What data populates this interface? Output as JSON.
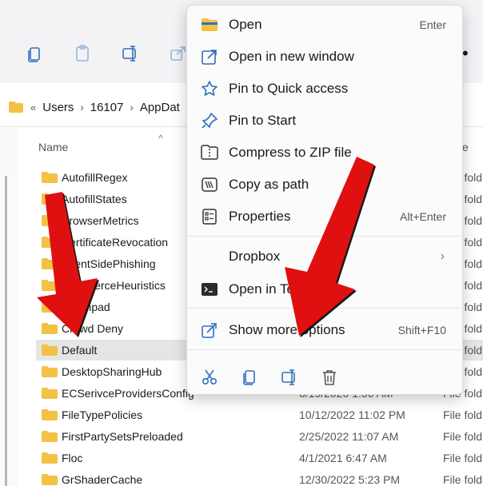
{
  "address": {
    "crumbs": [
      "Users",
      "16107",
      "AppDat"
    ]
  },
  "file_list": {
    "columns": {
      "name": "Name",
      "type_partial": "e"
    },
    "rows": [
      {
        "name": "AutofillRegex",
        "date": "",
        "type": "File fold"
      },
      {
        "name": "AutofillStates",
        "date": "",
        "type": "File fold"
      },
      {
        "name": "BrowserMetrics",
        "date": "",
        "type": "File fold"
      },
      {
        "name": "CertificateRevocation",
        "date": "",
        "type": "File fold"
      },
      {
        "name": "ClientSidePhishing",
        "date": "",
        "type": "File fold"
      },
      {
        "name": "CommerceHeuristics",
        "date": "",
        "type": "File fold"
      },
      {
        "name": "Crashpad",
        "date": "",
        "type": "File fold"
      },
      {
        "name": "Crowd Deny",
        "date": "",
        "type": "File fold"
      },
      {
        "name": "Default",
        "date": "",
        "type": "File fold",
        "selected": true
      },
      {
        "name": "DesktopSharingHub",
        "date": "",
        "type": "File fold"
      },
      {
        "name": "ECSerivceProvidersConfig",
        "date": "6/19/2020 1:56 AM",
        "type": "File fold"
      },
      {
        "name": "FileTypePolicies",
        "date": "10/12/2022 11:02 PM",
        "type": "File fold"
      },
      {
        "name": "FirstPartySetsPreloaded",
        "date": "2/25/2022 11:07 AM",
        "type": "File fold"
      },
      {
        "name": "Floc",
        "date": "4/1/2021 6:47 AM",
        "type": "File fold"
      },
      {
        "name": "GrShaderCache",
        "date": "12/30/2022 5:23 PM",
        "type": "File fold"
      }
    ]
  },
  "context_menu": {
    "items": [
      {
        "label": "Open",
        "shortcut": "Enter",
        "icon": "folder-icon"
      },
      {
        "label": "Open in new window",
        "shortcut": "",
        "icon": "open-external-icon"
      },
      {
        "label": "Pin to Quick access",
        "shortcut": "",
        "icon": "star-icon"
      },
      {
        "label": "Pin to Start",
        "shortcut": "",
        "icon": "pin-icon"
      },
      {
        "label": "Compress to ZIP file",
        "shortcut": "",
        "icon": "zip-icon"
      },
      {
        "label": "Copy as path",
        "shortcut": "",
        "icon": "copy-path-icon"
      },
      {
        "label": "Properties",
        "shortcut": "Alt+Enter",
        "icon": "properties-icon"
      }
    ],
    "dropbox": {
      "label": "Dropbox"
    },
    "terminal": {
      "label": "Open in Terminal"
    },
    "more": {
      "label": "Show more options",
      "shortcut": "Shift+F10"
    },
    "quick_actions": [
      "cut-icon",
      "copy-icon",
      "rename-icon",
      "delete-icon"
    ]
  },
  "colors": {
    "folder": "#f3c244",
    "accent": "#2f6fbf",
    "arrow": "#e01010"
  }
}
